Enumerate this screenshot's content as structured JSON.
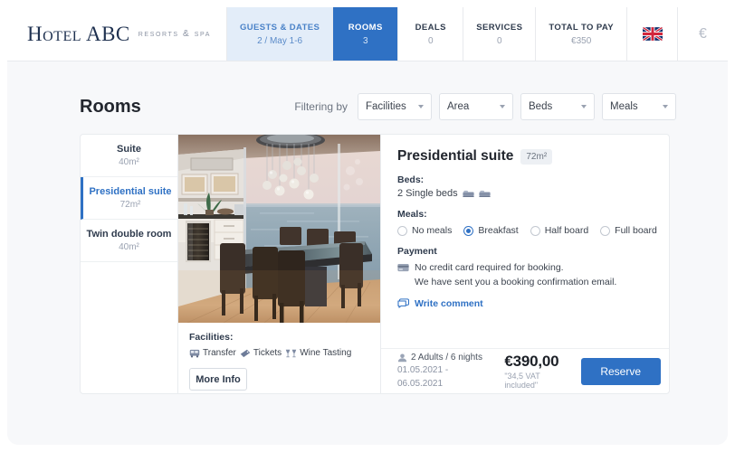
{
  "brand": {
    "name": "Hotel ABC",
    "tagline": "Resorts & Spa"
  },
  "nav": {
    "tabs": [
      {
        "title": "Guests & Dates",
        "sub": "2 / May 1-6",
        "state": "soft"
      },
      {
        "title": "Rooms",
        "sub": "3",
        "state": "active"
      },
      {
        "title": "Deals",
        "sub": "0",
        "state": "normal"
      },
      {
        "title": "Services",
        "sub": "0",
        "state": "normal"
      },
      {
        "title": "Total to pay",
        "sub": "€350",
        "state": "normal"
      }
    ],
    "language_icon": "uk-flag-icon",
    "currency_symbol": "€"
  },
  "page": {
    "title": "Rooms",
    "filter_label": "Filtering by",
    "filters": [
      {
        "label": "Facilities"
      },
      {
        "label": "Area"
      },
      {
        "label": "Beds"
      },
      {
        "label": "Meals"
      }
    ]
  },
  "rooms": [
    {
      "name": "Suite",
      "size": "40m²",
      "selected": false
    },
    {
      "name": "Presidential suite",
      "size": "72m²",
      "selected": true
    },
    {
      "name": "Twin double room",
      "size": "40m²",
      "selected": false
    }
  ],
  "photo": {
    "alt": "presidential-suite-dining-room-ocean-view",
    "facilities_label": "Facilities:",
    "facilities": [
      {
        "label": "Transfer",
        "icon": "bus-icon"
      },
      {
        "label": "Tickets",
        "icon": "ticket-icon"
      },
      {
        "label": "Wine Tasting",
        "icon": "wine-glasses-icon"
      }
    ],
    "more_info_label": "More Info"
  },
  "detail": {
    "title": "Presidential suite",
    "size_badge": "72m²",
    "beds_label": "Beds:",
    "beds_value": "2 Single beds",
    "bed_icon_count": 2,
    "meals_label": "Meals:",
    "meals_options": [
      {
        "label": "No meals",
        "selected": false
      },
      {
        "label": "Breakfast",
        "selected": true
      },
      {
        "label": "Half board",
        "selected": false
      },
      {
        "label": "Full board",
        "selected": false
      }
    ],
    "payment_label": "Payment",
    "payment_line1": "No credit card required for booking.",
    "payment_line2": "We have sent you a booking confirmation email.",
    "comment_label": "Write comment"
  },
  "footer": {
    "guests": "2 Adults / 6 nights",
    "dates": "01.05.2021 - 06.05.2021",
    "price": "€390,00",
    "vat": "\"34,5 VAT included\"",
    "reserve_label": "Reserve"
  },
  "colors": {
    "accent": "#2f71c4",
    "accent_soft": "#e3edf9",
    "text_dark": "#22262e",
    "text_muted": "#9aa2b1",
    "page_bg": "#f7f8fa"
  }
}
